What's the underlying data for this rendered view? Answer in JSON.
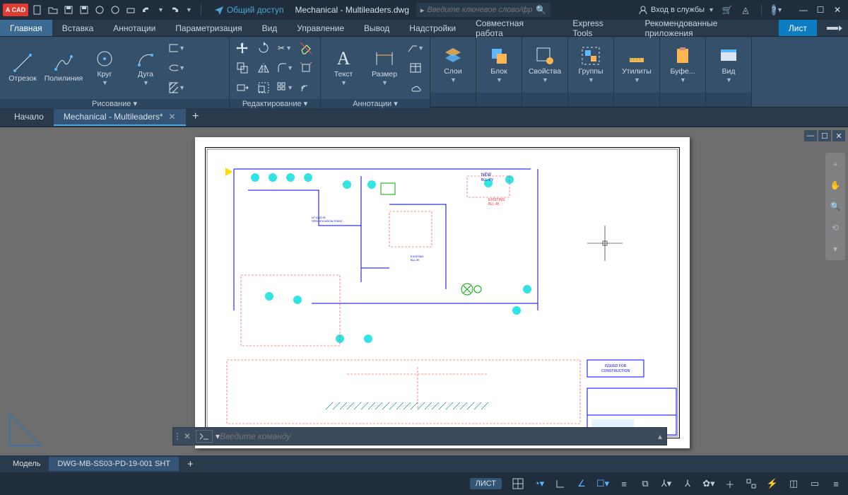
{
  "titlebar": {
    "app_badge": "A CAD",
    "share_label": "Общий доступ",
    "title": "Mechanical - Multileaders.dwg",
    "search_placeholder": "Введите ключевое слово/фразу",
    "signin_label": "Вход в службы"
  },
  "ribbon_tabs": [
    "Главная",
    "Вставка",
    "Аннотации",
    "Параметризация",
    "Вид",
    "Управление",
    "Вывод",
    "Надстройки",
    "Совместная работа",
    "Express Tools",
    "Рекомендованные приложения",
    "Лист"
  ],
  "panels": {
    "draw": {
      "title": "Рисование ▾",
      "tools": [
        "Отрезок",
        "Полилиния",
        "Круг",
        "Дуга"
      ]
    },
    "modify": {
      "title": "Редактирование ▾"
    },
    "annot": {
      "title": "Аннотации ▾",
      "tools": [
        "Текст",
        "Размер"
      ]
    },
    "layers": {
      "label": "Слои"
    },
    "block": {
      "label": "Блок"
    },
    "props": {
      "label": "Свойства"
    },
    "groups": {
      "label": "Группы"
    },
    "utils": {
      "label": "Утилиты"
    },
    "clip": {
      "label": "Буфе..."
    },
    "view": {
      "label": "Вид"
    }
  },
  "file_tabs": {
    "start": "Начало",
    "active": "Mechanical - Multileaders*"
  },
  "commandline": {
    "placeholder": "Введите команду"
  },
  "layout_tabs": {
    "model": "Модель",
    "sheet": "DWG-MB-SS03-PD-19-001 SHT"
  },
  "statusbar": {
    "sheet_tag": "ЛИСТ"
  },
  "drawing": {
    "labels": {
      "new": "NEW\nBLL-PY",
      "existing": "EXISTING\nBLL-RI",
      "issued": "ISSUED FOR\nCONSTRUCTION"
    }
  }
}
